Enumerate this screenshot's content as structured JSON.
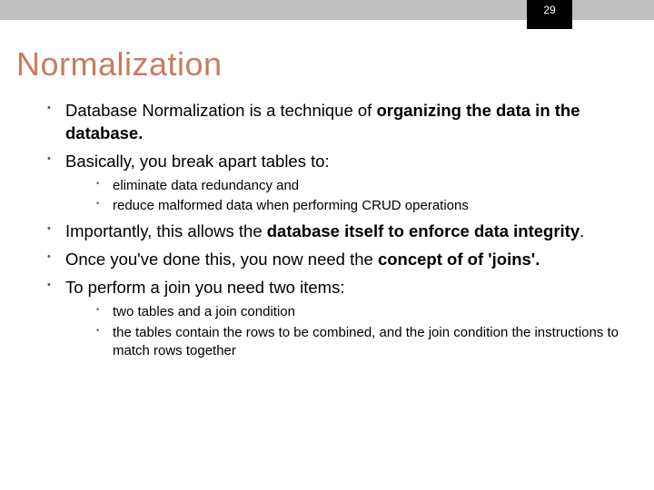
{
  "page_number": "29",
  "title": "Normalization",
  "bullets": {
    "b1a": "Database Normalization is a technique of ",
    "b1b": "organizing the data in the database.",
    "b2": "Basically, you break apart tables to:",
    "b2_sub1": "eliminate data redundancy and",
    "b2_sub2": "reduce malformed data when performing CRUD operations",
    "b3a": "Importantly, this allows the ",
    "b3b": "database itself to enforce data integrity",
    "b3c": ".",
    "b4a": "Once you've done this, you now need the ",
    "b4b": "concept of of 'joins'.",
    "b5": "To perform a join you need two items:",
    "b5_sub1": "two tables and a join condition",
    "b5_sub2": "the tables contain the rows to be combined, and the join condition the instructions to match rows together"
  }
}
